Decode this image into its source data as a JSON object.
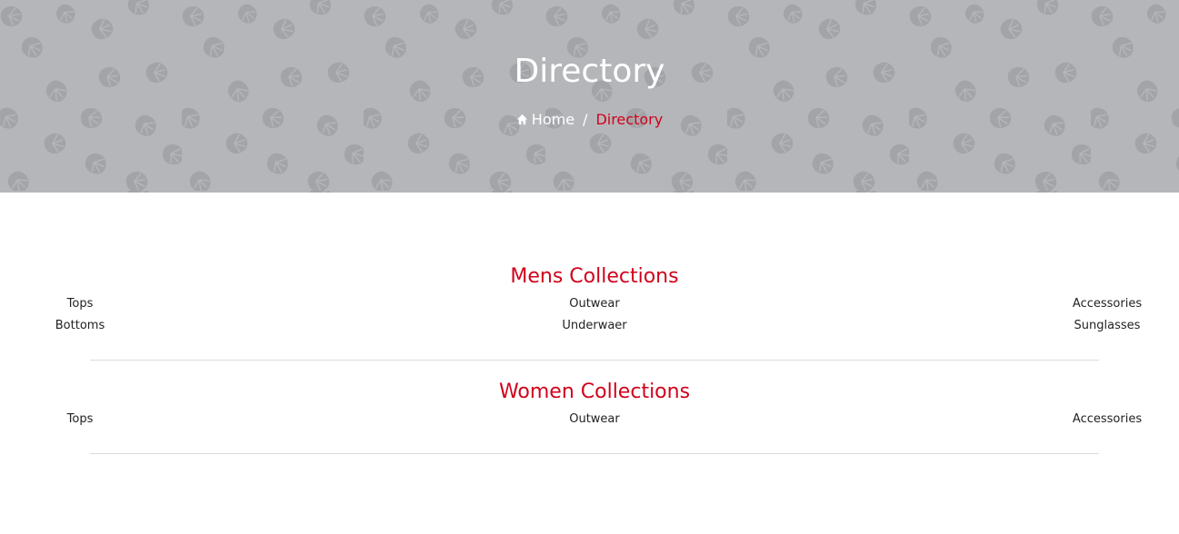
{
  "hero": {
    "title": "Directory",
    "background_color": "#b5b6b9",
    "pattern_icon": "monstera-leaf-icon"
  },
  "breadcrumb": {
    "home_icon": "home-icon",
    "home_label": "Home",
    "separator": "/",
    "current_label": "Directory"
  },
  "accent_color": "#d0021b",
  "sections": {
    "mens": {
      "title": "Mens Collections",
      "links": [
        "Tops",
        "Outwear",
        "Accessories",
        "Bottoms",
        "Underwaer",
        "Sunglasses"
      ]
    },
    "women": {
      "title": "Women Collections",
      "links": [
        "Tops",
        "Outwear",
        "Accessories"
      ]
    }
  }
}
